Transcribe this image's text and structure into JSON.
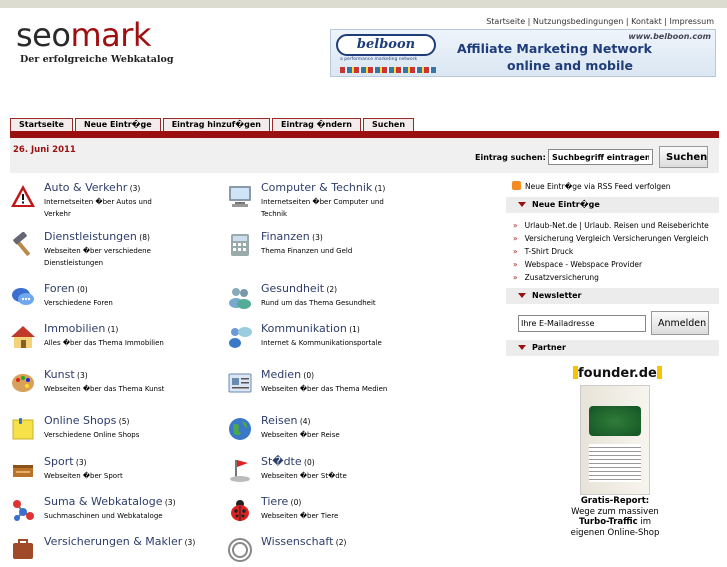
{
  "header": {
    "logo_part1": "seo",
    "logo_part2": "mark",
    "tagline": "Der erfolgreiche Webkatalog",
    "toplinks": [
      "Startseite",
      "Nutzungsbedingungen",
      "Kontakt",
      "Impressum"
    ],
    "separator": " | "
  },
  "banner": {
    "brand": "belboon",
    "brand_sub": "a performance marketing network",
    "url": "www.belboon.com",
    "line1": "Affiliate Marketing Network",
    "line2": "online and mobile"
  },
  "nav": [
    "Startseite",
    "Neue Eintr�ge",
    "Eintrag hinzuf�gen",
    "Eintrag �ndern",
    "Suchen"
  ],
  "date": "26. Juni 2011",
  "search": {
    "label": "Eintrag suchen:",
    "value": "Suchbegriff eintragen",
    "button": "Suchen"
  },
  "categories": [
    {
      "name": "Auto & Verkehr",
      "count": "(3)",
      "desc": "Internetseiten �ber Autos und Verkehr",
      "icon": "warning-icon"
    },
    {
      "name": "Computer & Technik",
      "count": "(1)",
      "desc": "Internetseiten �ber Computer und Technik",
      "icon": "computer-icon"
    },
    {
      "name": "Dienstleistungen",
      "count": "(8)",
      "desc": "Webseiten �ber verschiedene Dienstleistungen",
      "icon": "hammer-icon"
    },
    {
      "name": "Finanzen",
      "count": "(3)",
      "desc": "Thema Finanzen und Geld",
      "icon": "calculator-icon"
    },
    {
      "name": "Foren",
      "count": "(0)",
      "desc": "Verschiedene Foren",
      "icon": "chat-icon"
    },
    {
      "name": "Gesundheit",
      "count": "(2)",
      "desc": "Rund um das Thema Gesundheit",
      "icon": "people-icon"
    },
    {
      "name": "Immobilien",
      "count": "(1)",
      "desc": "Alles �ber das Thema Immobilien",
      "icon": "house-icon"
    },
    {
      "name": "Kommunikation",
      "count": "(1)",
      "desc": "Internet & Kommunikationsportale",
      "icon": "users-chat-icon"
    },
    {
      "name": "Kunst",
      "count": "(3)",
      "desc": "Webseiten �ber das Thema Kunst",
      "icon": "palette-icon"
    },
    {
      "name": "Medien",
      "count": "(0)",
      "desc": "Webseiten �ber das Thema Medien",
      "icon": "media-card-icon"
    },
    {
      "name": "Online Shops",
      "count": "(5)",
      "desc": "Verschiedene Online Shops",
      "icon": "note-icon"
    },
    {
      "name": "Reisen",
      "count": "(4)",
      "desc": "Webseiten �ber Reise",
      "icon": "globe-icon"
    },
    {
      "name": "Sport",
      "count": "(3)",
      "desc": "Webseiten �ber Sport",
      "icon": "sport-icon"
    },
    {
      "name": "St�dte",
      "count": "(0)",
      "desc": "Webseiten �ber St�dte",
      "icon": "city-flag-icon"
    },
    {
      "name": "Suma & Webkataloge",
      "count": "(3)",
      "desc": "Suchmaschinen und Webkataloge",
      "icon": "molecule-icon"
    },
    {
      "name": "Tiere",
      "count": "(0)",
      "desc": "Webseiten �ber Tiere",
      "icon": "ladybug-icon"
    },
    {
      "name": "Versicherungen & Makler",
      "count": "(3)",
      "desc": "",
      "icon": "insurance-icon"
    },
    {
      "name": "Wissenschaft",
      "count": "(2)",
      "desc": "",
      "icon": "science-icon"
    }
  ],
  "sidebar": {
    "rss": "Neue Eintr�ge via RSS Feed verfolgen",
    "new_title": "Neue Eintr�ge",
    "new_items": [
      "Urlaub-Net.de | Urlaub. Reisen und Reiseberichte",
      "Versicherung Vergleich Versicherungen Vergleich",
      "T-Shirt Druck",
      "Webspace - Webspace Provider",
      "Zusatzversicherung"
    ],
    "newsletter_title": "Newsletter",
    "newsletter_value": "Ihre E-Mailadresse",
    "newsletter_button": "Anmelden",
    "partner_title": "Partner",
    "partner_logo": "founder.de",
    "promo_line1": "Gratis-Report:",
    "promo_line2": "Wege zum massiven",
    "promo_line3": "Turbo-Traffic",
    "promo_line3b": " im",
    "promo_line4": "eigenen Online-Shop"
  },
  "colors": {
    "accent": "#9a1010",
    "link": "#2e3e6a"
  }
}
